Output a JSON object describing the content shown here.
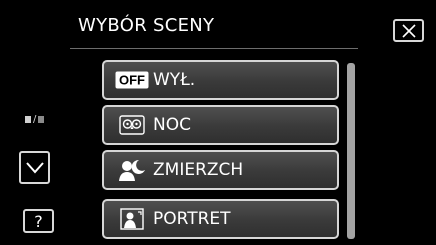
{
  "header": {
    "title": "WYBÓR SCENY"
  },
  "close_button": {
    "icon": "close-icon"
  },
  "side": {
    "page_indicator_icon": "page-toggle-icon",
    "down_icon": "chevron-down-icon",
    "help_label": "?"
  },
  "menu": {
    "items": [
      {
        "label": "WYŁ.",
        "icon": "off-icon",
        "icon_text": "OFF",
        "selected": true
      },
      {
        "label": "NOC",
        "icon": "owl-icon"
      },
      {
        "label": "ZMIERZCH",
        "icon": "twilight-icon"
      },
      {
        "label": "PORTRET",
        "icon": "portrait-icon"
      }
    ]
  },
  "colors": {
    "background": "#000000",
    "button_border": "#d6d6d6",
    "button_fill": "#3a3a3a",
    "scrollbar": "#a3a3a3"
  }
}
